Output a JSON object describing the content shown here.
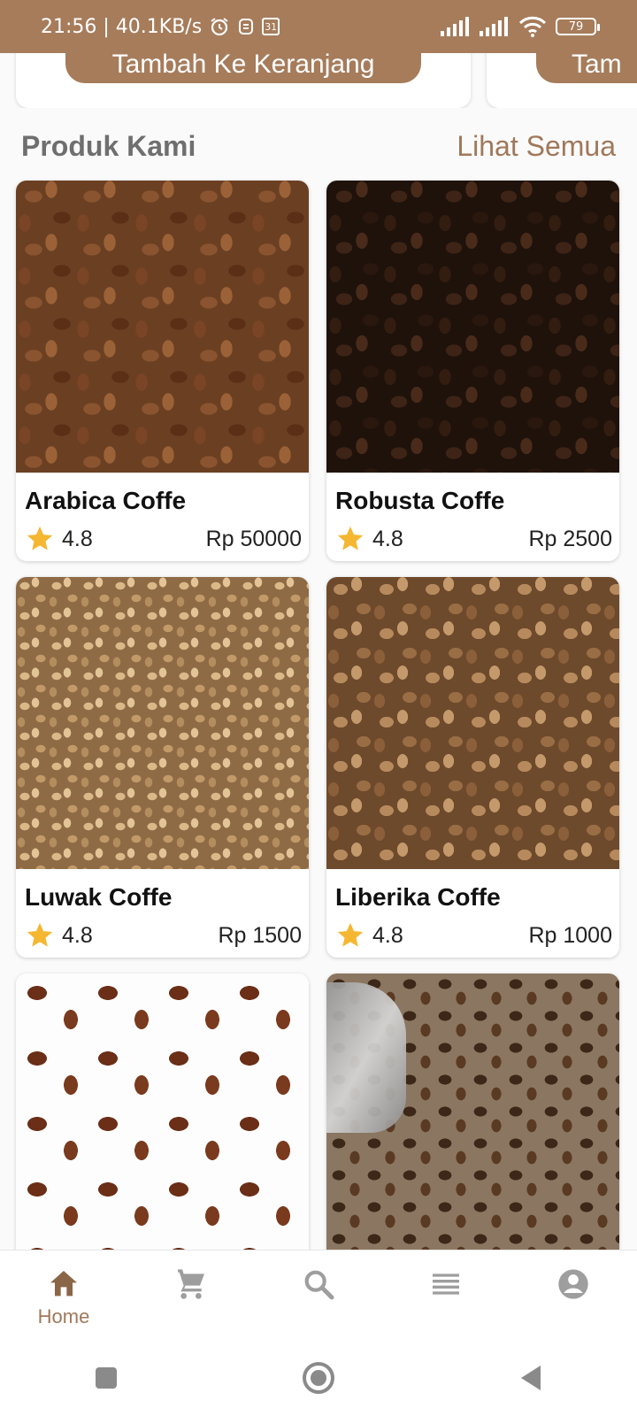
{
  "status_bar": {
    "time_speed": "21:56 | 40.1KB/s",
    "calendar_badge": "31",
    "battery": "79"
  },
  "carousel": {
    "add_to_cart_label": "Tambah Ke Keranjang",
    "add_to_cart_label_partial": "Tam"
  },
  "section": {
    "title": "Produk Kami",
    "see_all": "Lihat Semua"
  },
  "products": [
    {
      "name": "Arabica Coffe",
      "rating": "4.8",
      "price": "Rp 50000",
      "image": "arabica-beans"
    },
    {
      "name": "Robusta Coffe",
      "rating": "4.8",
      "price": "Rp 2500",
      "image": "robusta-beans"
    },
    {
      "name": "Luwak Coffe",
      "rating": "4.8",
      "price": "Rp 1500",
      "image": "luwak-beans"
    },
    {
      "name": "Liberika Coffe",
      "rating": "4.8",
      "price": "Rp 1000",
      "image": "liberika-beans"
    },
    {
      "name": "",
      "rating": "",
      "price": "",
      "image": "roasted-beans-white"
    },
    {
      "name": "",
      "rating": "",
      "price": "",
      "image": "roasted-beans-burlap"
    }
  ],
  "bottom_nav": {
    "home_label": "Home",
    "items": [
      "home-icon",
      "cart-icon",
      "search-icon",
      "list-icon",
      "account-icon"
    ]
  },
  "colors": {
    "brand": "#a67c5b",
    "accent_text": "#a0785a",
    "star": "#f5b731",
    "inactive_icon": "#9e9e9e"
  }
}
